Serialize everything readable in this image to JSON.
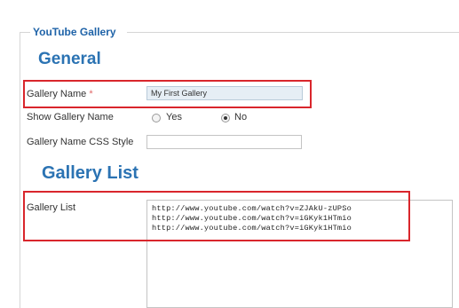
{
  "fieldset": {
    "legend": "YouTube Gallery"
  },
  "sections": {
    "general": "General",
    "gallery_list": "Gallery List"
  },
  "gallery_name": {
    "label": "Gallery Name",
    "required_marker": "*",
    "value": "My First Gallery"
  },
  "show_gallery_name": {
    "label": "Show Gallery Name",
    "options": [
      {
        "label": "Yes",
        "checked": false
      },
      {
        "label": "No",
        "checked": true
      }
    ]
  },
  "css_style": {
    "label": "Gallery Name CSS Style",
    "value": ""
  },
  "gallery_list": {
    "label": "Gallery List",
    "lines": [
      "http://www.youtube.com/watch?v=ZJAkU-zUPSo",
      "http://www.youtube.com/watch?v=iGKyk1HTmio",
      "http://www.youtube.com/watch?v=iGKyk1HTmio"
    ]
  },
  "colors": {
    "heading": "#2b73b3",
    "legend": "#1f63a8",
    "highlight": "#d9262c",
    "name_input_bg": "#e6eef5"
  }
}
